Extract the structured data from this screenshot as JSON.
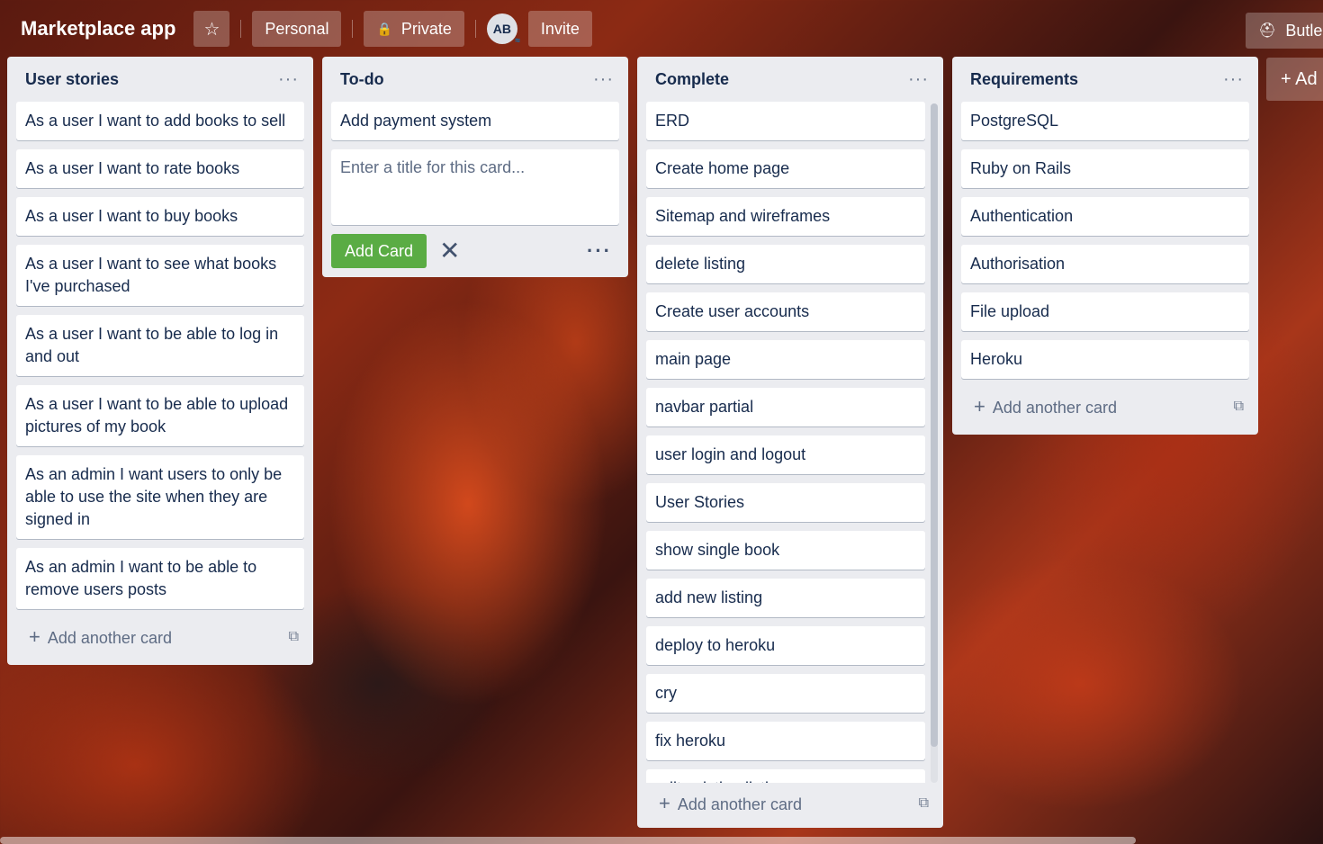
{
  "header": {
    "board_title": "Marketplace app",
    "workspace_label": "Personal",
    "visibility_label": "Private",
    "avatar_initials": "AB",
    "invite_label": "Invite",
    "butler_label": "Butler"
  },
  "add_list_label": "+ Ad",
  "lists": [
    {
      "title": "User stories",
      "menu": "...",
      "cards": [
        "As a user I want to add books to sell",
        "As a user I want to rate books",
        "As a user I want to buy books",
        "As a user I want to see what books I've purchased",
        "As a user I want to be able to log in and out",
        "As a user I want to be able to upload pictures of my book",
        "As an admin I want users to only be able to use the site when they are signed in",
        "As an admin I want to be able to remove users posts"
      ],
      "add_card_label": "Add another card"
    },
    {
      "title": "To-do",
      "menu": "...",
      "cards": [
        "Add payment system"
      ],
      "composer_placeholder": "Enter a title for this card...",
      "add_button_label": "Add Card"
    },
    {
      "title": "Complete",
      "menu": "...",
      "cards": [
        "ERD",
        "Create home page",
        "Sitemap and wireframes",
        "delete listing",
        "Create user accounts",
        "main page",
        "navbar partial",
        "user login and logout",
        "User Stories",
        "show single book",
        "add new listing",
        "deploy to heroku",
        "cry",
        "fix heroku",
        "edit existing listing"
      ],
      "add_card_label": "Add another card"
    },
    {
      "title": "Requirements",
      "menu": "...",
      "cards": [
        "PostgreSQL",
        "Ruby on Rails",
        "Authentication",
        "Authorisation",
        "File upload",
        "Heroku"
      ],
      "add_card_label": "Add another card"
    }
  ]
}
